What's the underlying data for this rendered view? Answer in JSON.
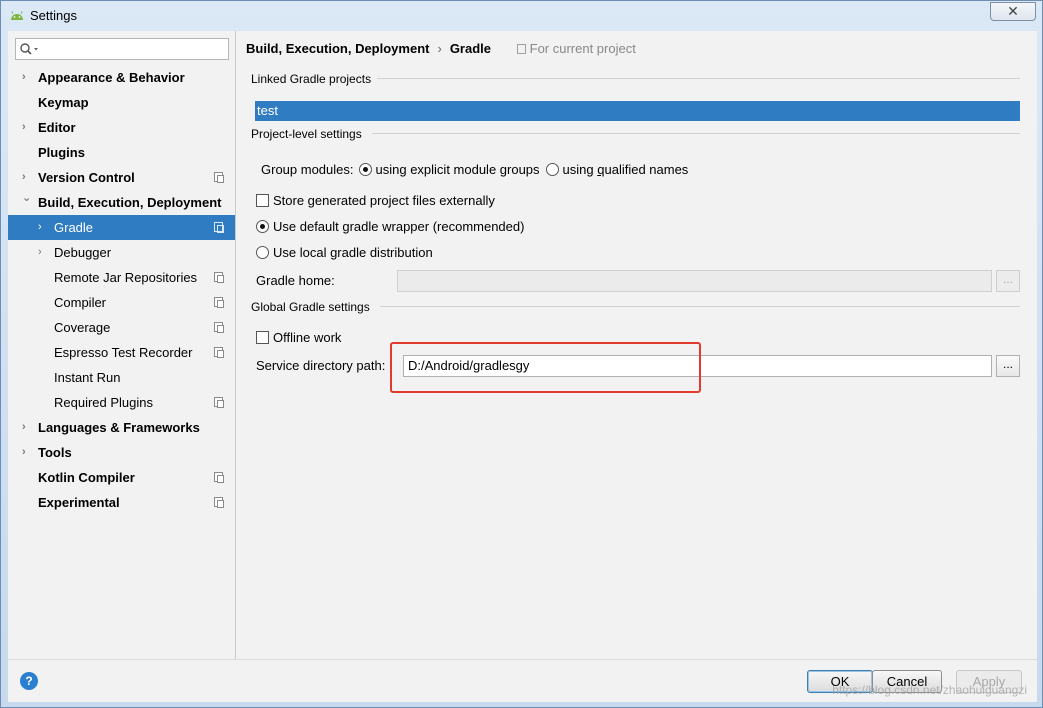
{
  "window": {
    "title": "Settings",
    "close_glyph": "✕"
  },
  "sidebar": {
    "search_placeholder": "",
    "items": [
      {
        "label": "Appearance & Behavior",
        "chevron": "›",
        "bold": true,
        "indent": 0,
        "copy": false
      },
      {
        "label": "Keymap",
        "chevron": "",
        "bold": true,
        "indent": 0,
        "copy": false
      },
      {
        "label": "Editor",
        "chevron": "›",
        "bold": true,
        "indent": 0,
        "copy": false
      },
      {
        "label": "Plugins",
        "chevron": "",
        "bold": true,
        "indent": 0,
        "copy": false
      },
      {
        "label": "Version Control",
        "chevron": "›",
        "bold": true,
        "indent": 0,
        "copy": true
      },
      {
        "label": "Build, Execution, Deployment",
        "chevron": "⌄",
        "bold": true,
        "indent": 0,
        "copy": false
      },
      {
        "label": "Gradle",
        "chevron": "›",
        "bold": false,
        "indent": 1,
        "copy": true,
        "selected": true
      },
      {
        "label": "Debugger",
        "chevron": "›",
        "bold": false,
        "indent": 1,
        "copy": false
      },
      {
        "label": "Remote Jar Repositories",
        "chevron": "",
        "bold": false,
        "indent": 1,
        "copy": true
      },
      {
        "label": "Compiler",
        "chevron": "",
        "bold": false,
        "indent": 1,
        "copy": true
      },
      {
        "label": "Coverage",
        "chevron": "",
        "bold": false,
        "indent": 1,
        "copy": true
      },
      {
        "label": "Espresso Test Recorder",
        "chevron": "",
        "bold": false,
        "indent": 1,
        "copy": true
      },
      {
        "label": "Instant Run",
        "chevron": "",
        "bold": false,
        "indent": 1,
        "copy": false
      },
      {
        "label": "Required Plugins",
        "chevron": "",
        "bold": false,
        "indent": 1,
        "copy": true
      },
      {
        "label": "Languages & Frameworks",
        "chevron": "›",
        "bold": true,
        "indent": 0,
        "copy": false
      },
      {
        "label": "Tools",
        "chevron": "›",
        "bold": true,
        "indent": 0,
        "copy": false
      },
      {
        "label": "Kotlin Compiler",
        "chevron": "",
        "bold": true,
        "indent": 0,
        "copy": true
      },
      {
        "label": "Experimental",
        "chevron": "",
        "bold": true,
        "indent": 0,
        "copy": true
      }
    ]
  },
  "content": {
    "breadcrumb": {
      "parent": "Build, Execution, Deployment",
      "separator": "›",
      "current": "Gradle",
      "scope": "For current project"
    },
    "linked_section": {
      "title": "Linked Gradle projects",
      "projects": [
        "test"
      ]
    },
    "project_section": {
      "title": "Project-level settings",
      "group_modules_label": "Group modules:",
      "option_explicit": "using explicit module groups",
      "option_qualified_pre": "using ",
      "option_qualified_mn": "q",
      "option_qualified_post": "ualified names",
      "store_external_label": "Store generated project files externally",
      "default_wrapper_label": "Use default gradle wrapper (recommended)",
      "local_distribution_label": "Use local gradle distribution",
      "gradle_home_label": "Gradle home:",
      "gradle_home_value": "",
      "browse_label": "..."
    },
    "global_section": {
      "title": "Global Gradle settings",
      "offline_label": "Offline work",
      "service_dir_label": "Service directory path:",
      "service_dir_value": "D:/Android/gradlesgy",
      "browse_label": "..."
    }
  },
  "footer": {
    "help": "?",
    "ok": "OK",
    "cancel": "Cancel",
    "apply": "Apply",
    "watermark": "https://blog.csdn.net/zhaohuiguangzi"
  },
  "colors": {
    "selection": "#2f7cc3",
    "highlight_box": "#e23a2e",
    "help_icon": "#2a7fd0"
  }
}
